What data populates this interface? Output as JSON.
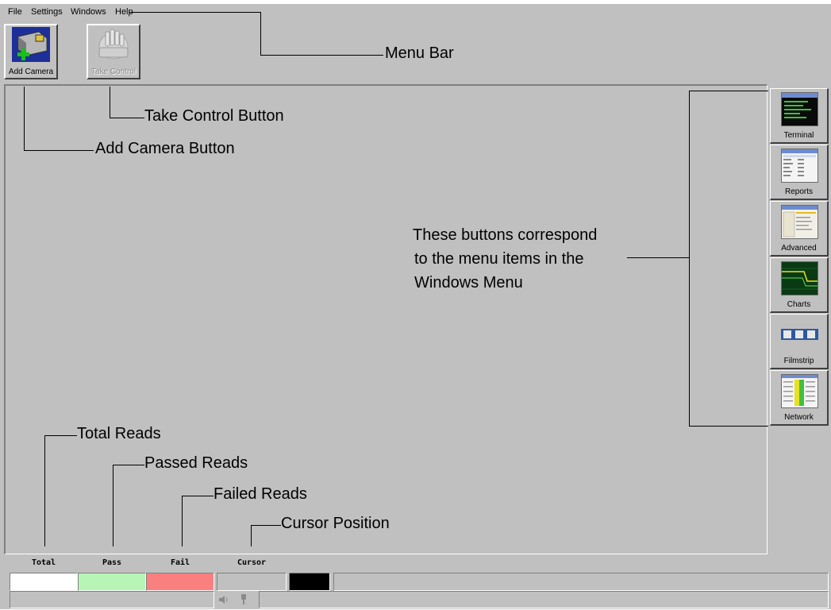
{
  "menu": {
    "file": "File",
    "settings": "Settings",
    "windows": "Windows",
    "help": "Help"
  },
  "toolbar": {
    "add_camera": "Add Camera",
    "take_control": "Take Control"
  },
  "side_panel": {
    "items": [
      {
        "label": "Terminal",
        "icon": "terminal-icon"
      },
      {
        "label": "Reports",
        "icon": "reports-icon"
      },
      {
        "label": "Advanced",
        "icon": "advanced-icon"
      },
      {
        "label": "Charts",
        "icon": "charts-icon"
      },
      {
        "label": "Filmstrip",
        "icon": "filmstrip-icon"
      },
      {
        "label": "Network",
        "icon": "network-icon"
      }
    ]
  },
  "annotations": {
    "menu_bar": "Menu Bar",
    "take_control_button": "Take Control Button",
    "add_camera_button": "Add Camera Button",
    "buttons_note_line1": "These buttons correspond",
    "buttons_note_line2": "to the menu items in the",
    "buttons_note_line3": "Windows Menu",
    "total_reads": "Total Reads",
    "passed_reads": "Passed Reads",
    "failed_reads": "Failed Reads",
    "cursor_position": "Cursor Position"
  },
  "status": {
    "total_label": "Total",
    "pass_label": "Pass",
    "fail_label": "Fail",
    "cursor_label": "Cursor",
    "total_value": "",
    "pass_value": "",
    "fail_value": "",
    "cursor_value": ""
  },
  "colors": {
    "window_bg": "#c0c0c0",
    "total_bg": "#ffffff",
    "pass_bg": "#b7f5b7",
    "fail_bg": "#fa8080",
    "indicator_bg": "#000000"
  }
}
